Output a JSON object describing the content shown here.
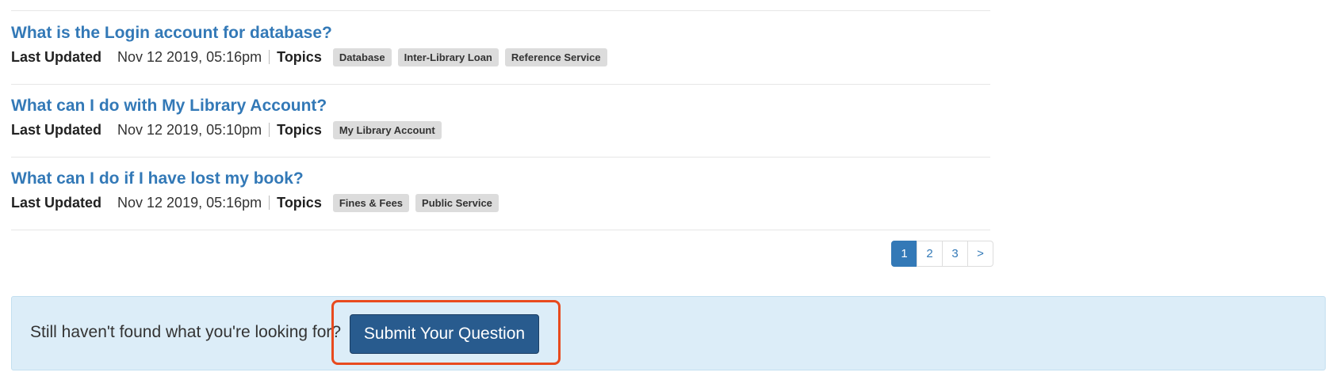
{
  "faq": {
    "items": [
      {
        "question": "What is the Login account for database?",
        "last_updated_label": "Last Updated",
        "date": "Nov 12 2019, 05:16pm",
        "topics_label": "Topics",
        "tags": [
          "Database",
          "Inter-Library Loan",
          "Reference Service"
        ]
      },
      {
        "question": "What can I do with My Library Account?",
        "last_updated_label": "Last Updated",
        "date": "Nov 12 2019, 05:10pm",
        "topics_label": "Topics",
        "tags": [
          "My Library Account"
        ]
      },
      {
        "question": "What can I do if I have lost my book?",
        "last_updated_label": "Last Updated",
        "date": "Nov 12 2019, 05:16pm",
        "topics_label": "Topics",
        "tags": [
          "Fines & Fees",
          "Public Service"
        ]
      }
    ]
  },
  "pagination": {
    "pages": [
      "1",
      "2",
      "3"
    ],
    "current": "1",
    "next_label": ">"
  },
  "callout": {
    "text": "Still haven't found what you're looking for?",
    "button_label": "Submit Your Question",
    "highlight_color": "#e84a1e"
  },
  "colors": {
    "link": "#3379b7",
    "button": "#285b8e",
    "callout_bg": "#dcedf8",
    "tag_bg": "#dcdcdc"
  }
}
